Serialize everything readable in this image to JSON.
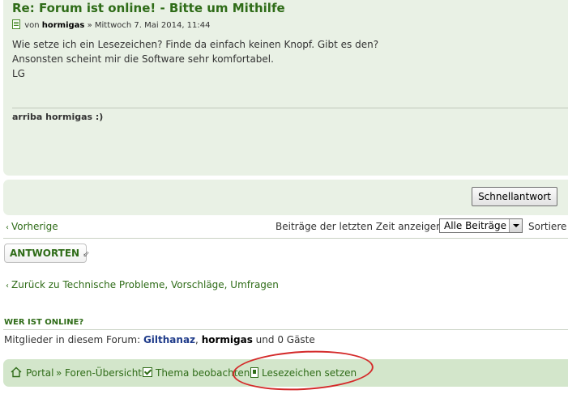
{
  "post": {
    "title": "Re: Forum ist online! - Bitte um Mithilfe",
    "meta_prefix": "von",
    "author": "hormigas",
    "meta_suffix": "» Mittwoch 7. Mai 2014, 11:44",
    "body_lines": [
      "Wie setze ich ein Lesezeichen? Finde da einfach keinen Knopf. Gibt es den?",
      "Ansonsten scheint mir die Software sehr komfortabel.",
      "LG"
    ],
    "signature": "arriba hormigas :)"
  },
  "quickreply": {
    "button_label": "Schnellantwort"
  },
  "nav": {
    "prev_label": "Vorherige",
    "sort_label": "Beiträge der letzten Zeit anzeigen:",
    "select_value": "Alle Beiträge",
    "sort_label2": "Sortiere"
  },
  "reply_button": {
    "label": "ANTWORTEN"
  },
  "back_link": {
    "label": "Zurück zu Technische Probleme, Vorschläge, Umfragen"
  },
  "online": {
    "title": "WER IST ONLINE?",
    "prefix": "Mitglieder in diesem Forum:",
    "user1": "Gilthanaz",
    "comma": ",",
    "user2": "hormigas",
    "suffix": "und 0 Gäste"
  },
  "footer": {
    "portal": "Portal",
    "separator": "»",
    "foren_uebersicht": "Foren-Übersicht",
    "watch_topic": "Thema beobachten",
    "bookmark": "Lesezeichen setzen"
  },
  "colors": {
    "link_green": "#2f6c18",
    "panel_bg": "#e9f1e5",
    "footer_bg": "#d3e6cb",
    "user_blue": "#1f3b8a",
    "annotation_red": "#d42a2a"
  },
  "icons": [
    "post-icon",
    "arrow-left-icon",
    "reply-icon",
    "house-icon",
    "checkbox-icon",
    "bookmark-icon",
    "select-arrow-icon"
  ]
}
